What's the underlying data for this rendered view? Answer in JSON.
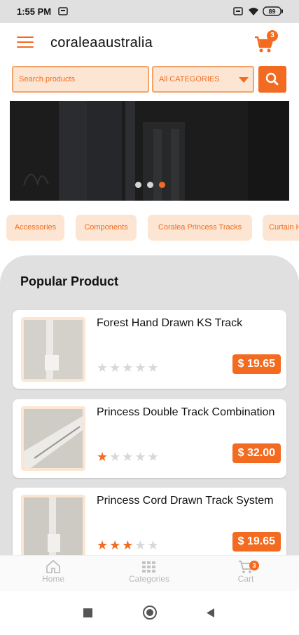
{
  "status_bar": {
    "time": "1:55 PM",
    "battery": "89"
  },
  "app_bar": {
    "title": "coraleaaustralia",
    "cart_count": "3"
  },
  "search": {
    "placeholder": "Search products",
    "category_selected": "All CATEGORIES"
  },
  "carousel": {
    "slide_count": 3,
    "active_slide": 3
  },
  "categories": [
    "Accessories",
    "Components",
    "Coralea Princess Tracks",
    "Curtain Hooks"
  ],
  "popular": {
    "title": "Popular Product",
    "products": [
      {
        "name": "Forest Hand Drawn KS Track",
        "price": "$ 19.65",
        "rating": 0
      },
      {
        "name": "Princess Double Track Combination",
        "price": "$ 32.00",
        "rating": 1
      },
      {
        "name": "Princess Cord Drawn Track System",
        "price": "$ 19.65",
        "rating": 3
      }
    ]
  },
  "bottom_nav": {
    "home": "Home",
    "categories": "Categories",
    "cart": "Cart",
    "cart_count": "3"
  },
  "colors": {
    "accent": "#f26b21",
    "accent_light": "#fce6d3",
    "panel_gray": "#e0e0e0",
    "star_gray": "#d8d8d8"
  },
  "icons": [
    "menu-icon",
    "cart-icon",
    "search-icon",
    "home-icon",
    "grid-icon",
    "wifi-icon",
    "battery-icon"
  ]
}
